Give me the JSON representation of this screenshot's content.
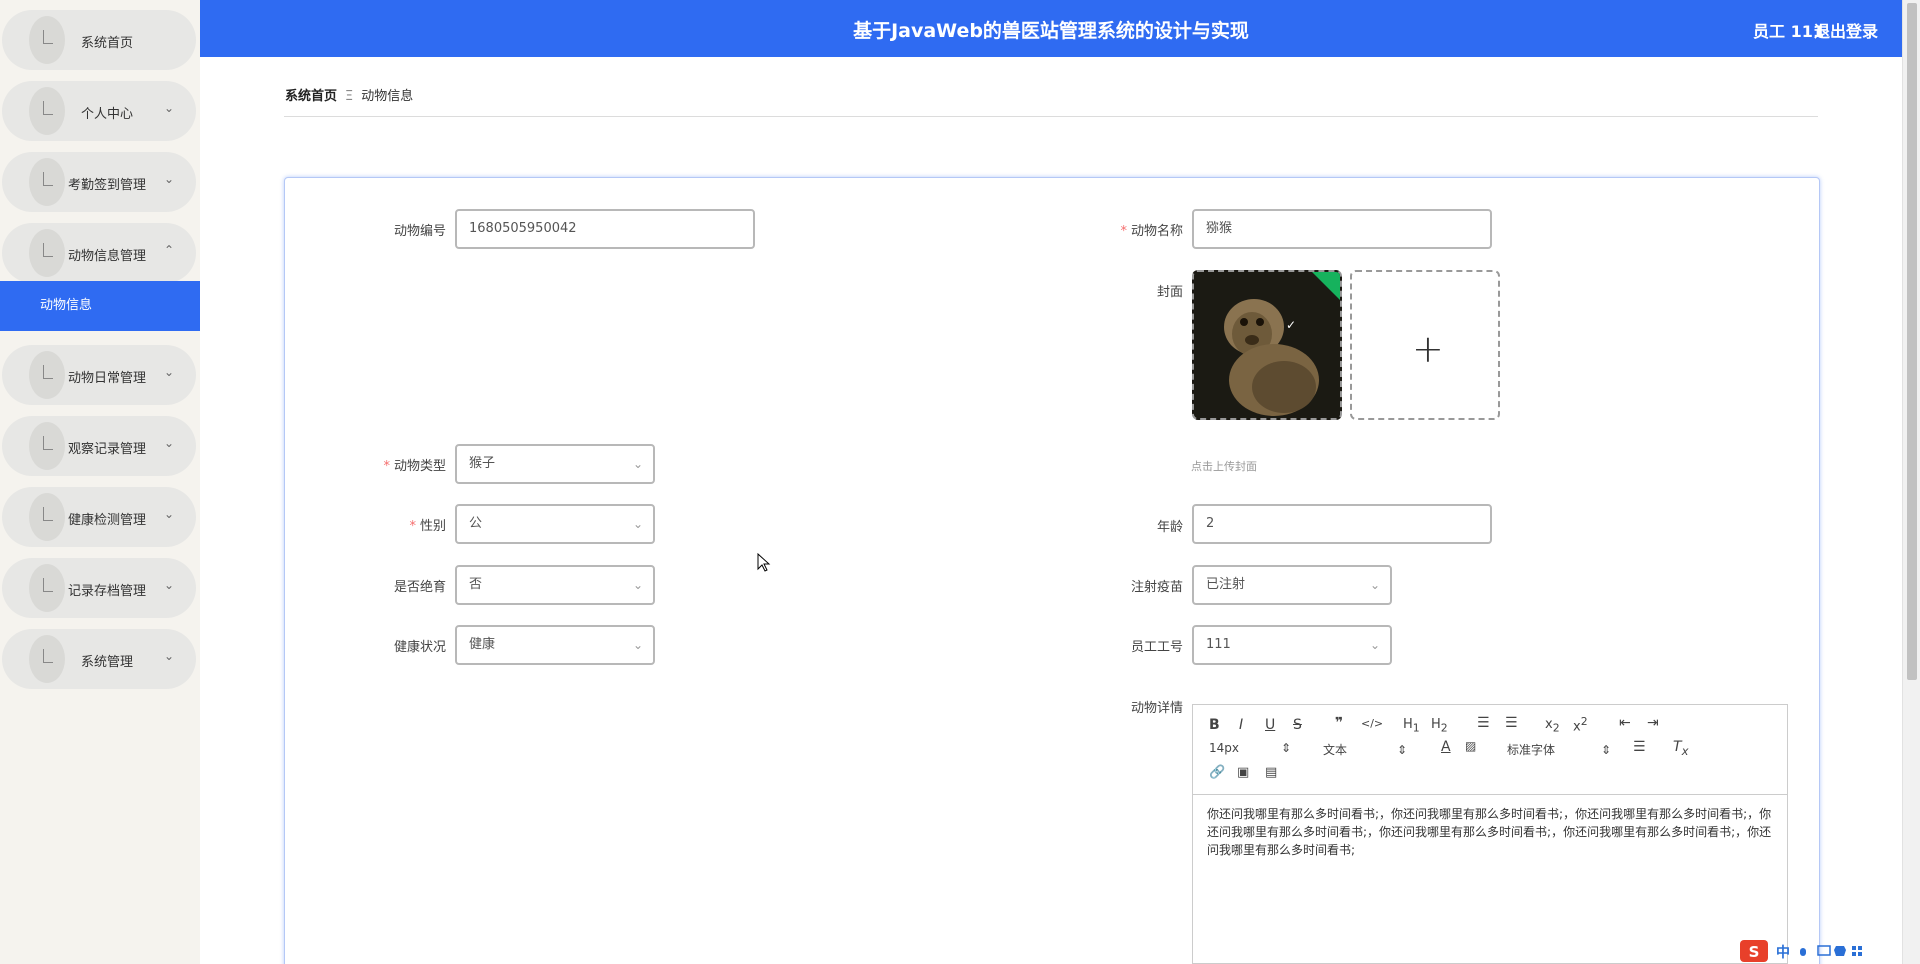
{
  "sidebar": {
    "items": [
      {
        "label": "系统首页",
        "arrow": ""
      },
      {
        "label": "个人中心",
        "arrow": "⌄"
      },
      {
        "label": "考勤签到管理",
        "arrow": "⌄"
      },
      {
        "label": "动物信息管理",
        "arrow": "⌃"
      },
      {
        "label": "动物日常管理",
        "arrow": "⌄"
      },
      {
        "label": "观察记录管理",
        "arrow": "⌄"
      },
      {
        "label": "健康检测管理",
        "arrow": "⌄"
      },
      {
        "label": "记录存档管理",
        "arrow": "⌄"
      },
      {
        "label": "系统管理",
        "arrow": "⌄"
      }
    ],
    "active_sub": "动物信息"
  },
  "header": {
    "title": "基于JavaWeb的兽医站管理系统的设计与实现",
    "user": "员工 111",
    "logout": "退出登录"
  },
  "breadcrumb": {
    "home": "系统首页",
    "separator": "Ξ",
    "current": "动物信息"
  },
  "form": {
    "animal_no": {
      "label": "动物编号",
      "value": "1680505950042"
    },
    "animal_name": {
      "label": "动物名称",
      "value": "猕猴"
    },
    "cover": {
      "label": "封面",
      "tip": "点击上传封面"
    },
    "animal_type": {
      "label": "动物类型",
      "value": "猴子"
    },
    "gender": {
      "label": "性别",
      "value": "公"
    },
    "age": {
      "label": "年龄",
      "value": "2"
    },
    "neutered": {
      "label": "是否绝育",
      "value": "否"
    },
    "vaccine": {
      "label": "注射疫苗",
      "value": "已注射"
    },
    "health": {
      "label": "健康状况",
      "value": "健康"
    },
    "staff_no": {
      "label": "员工工号",
      "value": "111"
    },
    "detail": {
      "label": "动物详情",
      "content": "你还问我哪里有那么多时间看书;，你还问我哪里有那么多时间看书;，你还问我哪里有那么多时间看书;，你还问我哪里有那么多时间看书;，你还问我哪里有那么多时间看书;，你还问我哪里有那么多时间看书;，你还问我哪里有那么多时间看书;"
    }
  },
  "editor_toolbar": {
    "font_size": "14px",
    "text_style": "文本",
    "font_family": "标准字体"
  },
  "ime": {
    "lang": "中"
  },
  "colors": {
    "primary": "#2f6bf2",
    "required": "#f56c6c",
    "upload_success": "#16b25d"
  }
}
